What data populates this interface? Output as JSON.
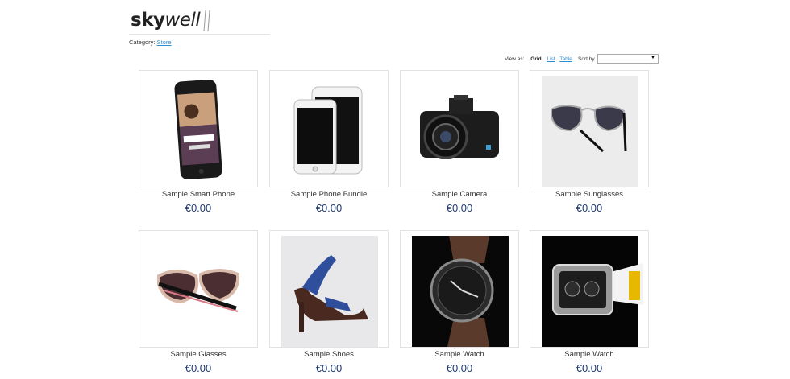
{
  "logo": {
    "part1": "sky",
    "part2": "well"
  },
  "category": {
    "label": "Category:",
    "link": "Store"
  },
  "toolbar": {
    "view_as_label": "View as:",
    "grid": "Grid",
    "list": "List",
    "table": "Table",
    "sort_by_label": "Sort by",
    "sort_value": ""
  },
  "products": [
    {
      "name": "Sample Smart Phone",
      "price": "€0.00",
      "icon": "smartphone"
    },
    {
      "name": "Sample Phone Bundle",
      "price": "€0.00",
      "icon": "phone-bundle"
    },
    {
      "name": "Sample Camera",
      "price": "€0.00",
      "icon": "camera"
    },
    {
      "name": "Sample Sunglasses",
      "price": "€0.00",
      "icon": "sunglasses"
    },
    {
      "name": "Sample Glasses",
      "price": "€0.00",
      "icon": "glasses"
    },
    {
      "name": "Sample Shoes",
      "price": "€0.00",
      "icon": "shoes"
    },
    {
      "name": "Sample Watch",
      "price": "€0.00",
      "icon": "watch"
    },
    {
      "name": "Sample Watch",
      "price": "€0.00",
      "icon": "watch"
    }
  ],
  "colors": {
    "link": "#2a8fd6",
    "price": "#1f3b73",
    "border": "#e2e2e2"
  }
}
